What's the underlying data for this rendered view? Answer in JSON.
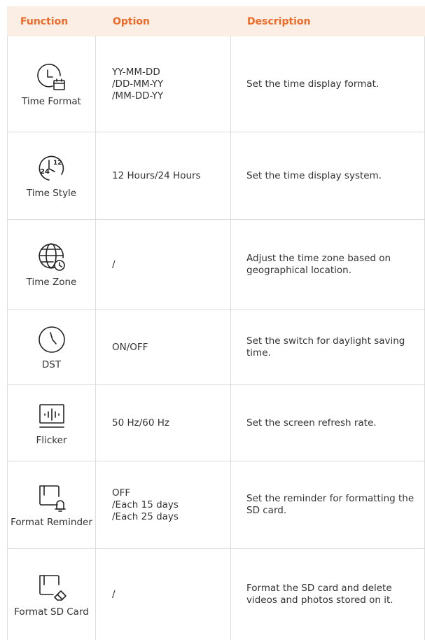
{
  "header": {
    "function": "Function",
    "option": "Option",
    "description": "Description"
  },
  "rows": [
    {
      "icon": "clock-calendar-icon",
      "name": "Time Format",
      "option": "YY-MM-DD\n/DD-MM-YY\n/MM-DD-YY",
      "description": "Set the time display format."
    },
    {
      "icon": "clock-24-12-icon",
      "name": "Time Style",
      "option": "12 Hours/24 Hours",
      "description": "Set the time display system."
    },
    {
      "icon": "globe-clock-icon",
      "name": "Time Zone",
      "option": "/",
      "description": "Adjust the time zone based on geographical location."
    },
    {
      "icon": "clock-icon",
      "name": "DST",
      "option": "ON/OFF",
      "description": "Set the switch for daylight saving time."
    },
    {
      "icon": "monitor-waveform-icon",
      "name": "Flicker",
      "option": "50 Hz/60 Hz",
      "description": "Set the screen refresh rate."
    },
    {
      "icon": "sd-card-bell-icon",
      "name": "Format Reminder",
      "option": "OFF\n/Each 15 days\n/Each 25 days",
      "description": "Set the reminder for formatting the SD card."
    },
    {
      "icon": "sd-card-eraser-icon",
      "name": "Format SD Card",
      "option": "/",
      "description": "Format the SD card and delete videos and photos stored on it."
    }
  ]
}
